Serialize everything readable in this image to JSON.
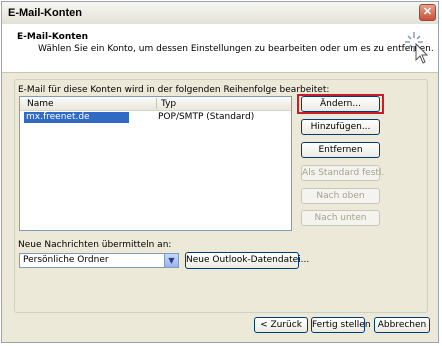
{
  "window": {
    "title": "E-Mail-Konten",
    "close_icon": "close-icon"
  },
  "header": {
    "title": "E-Mail-Konten",
    "subtitle": "Wählen Sie ein Konto, um dessen Einstellungen zu bearbeiten oder um es zu entfernen.",
    "icon": "wizard-sparkle-icon"
  },
  "accounts": {
    "label": "E-Mail für diese Konten wird in der folgenden Reihenfolge bearbeitet:",
    "columns": [
      "Name",
      "Typ"
    ],
    "rows": [
      {
        "name": "mx.freenet.de",
        "type": "POP/SMTP (Standard)",
        "selected": true
      }
    ]
  },
  "side_buttons": {
    "change": "Ändern...",
    "add": "Hinzufügen...",
    "remove": "Entfernen",
    "set_default": "Als Standard festl.",
    "move_up": "Nach oben",
    "move_down": "Nach unten"
  },
  "delivery": {
    "label": "Neue Nachrichten übermitteln an:",
    "selected": "Persönliche Ordner",
    "new_datafile": "Neue Outlook-Datendatei..."
  },
  "footer": {
    "back": "< Zurück",
    "finish": "Fertig stellen",
    "cancel": "Abbrechen"
  },
  "colors": {
    "selection": "#316ac5",
    "highlight_frame": "#c81e2a",
    "dialog_bg": "#ece9d8"
  }
}
